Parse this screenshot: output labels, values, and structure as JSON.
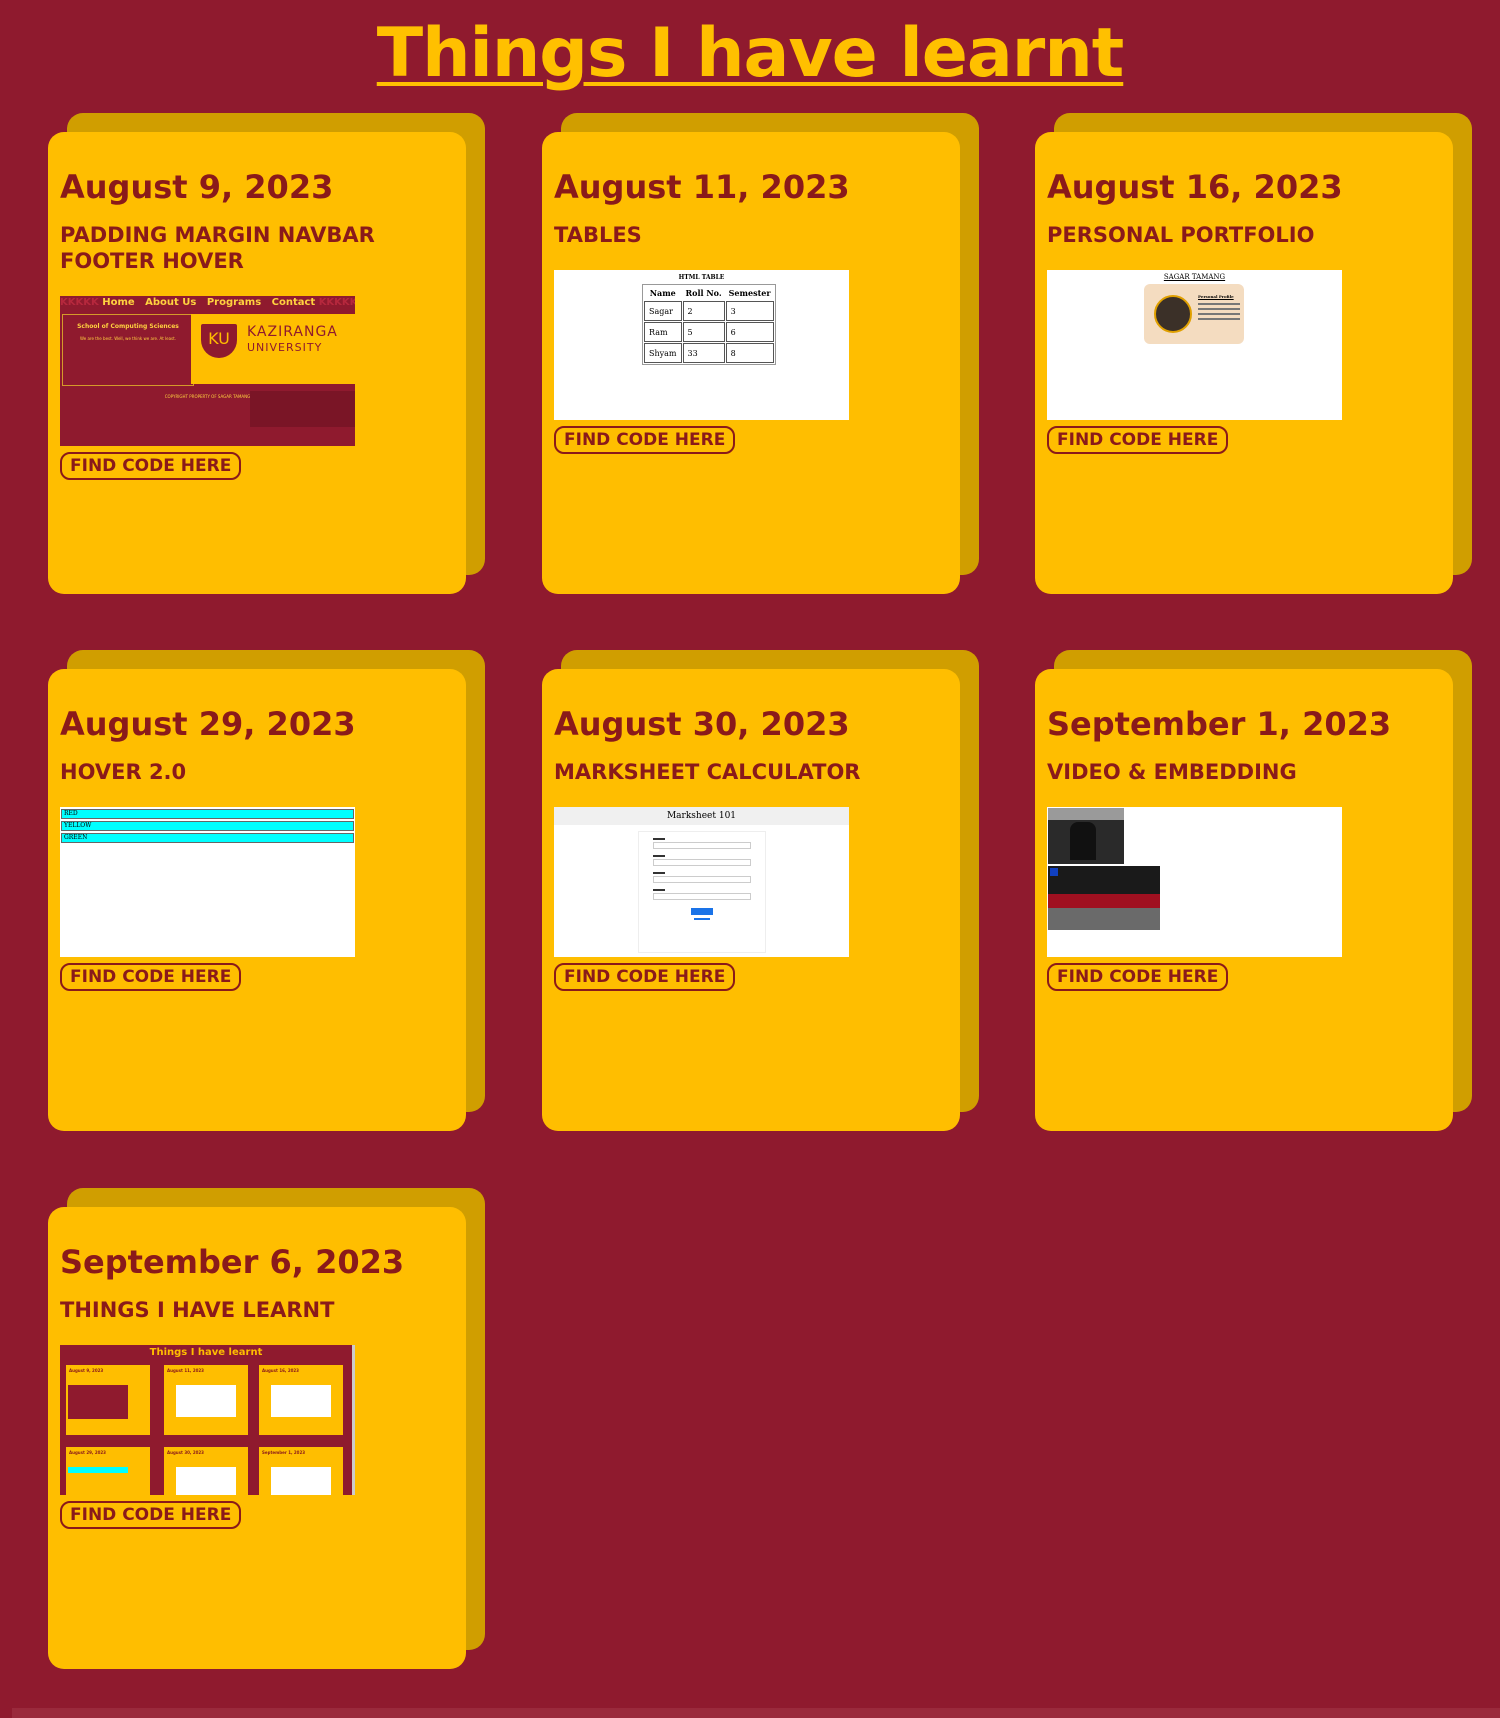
{
  "page": {
    "title": "Things I have learnt"
  },
  "cards": [
    {
      "date": "August 9, 2023",
      "title": "PADDING MARGIN NAVBAR FOOTER HOVER",
      "button": "FIND CODE HERE",
      "thumb": {
        "nav_filler": "KKKKK",
        "nav": [
          "Home",
          "About Us",
          "Programs",
          "Contact"
        ],
        "heading": "School of Computing Sciences",
        "tagline": "We are the best. Well, we think we are. At least.",
        "logo_mark": "KU",
        "logo_name_1": "KAZIRANGA",
        "logo_name_2": "UNIVERSITY",
        "footer": "COPYRIGHT PROPERTY OF SAGAR TAMANG"
      }
    },
    {
      "date": "August 11, 2023",
      "title": "TABLES",
      "button": "FIND CODE HERE",
      "thumb": {
        "caption": "HTML TABLE",
        "headers": [
          "Name",
          "Roll No.",
          "Semester"
        ],
        "rows": [
          [
            "Sagar",
            "2",
            "3"
          ],
          [
            "Ram",
            "5",
            "6"
          ],
          [
            "Shyam",
            "33",
            "8"
          ]
        ]
      }
    },
    {
      "date": "August 16, 2023",
      "title": "PERSONAL PORTFOLIO",
      "button": "FIND CODE HERE",
      "thumb": {
        "name": "SAGAR TAMANG",
        "profile_label": "Personal Profile"
      }
    },
    {
      "date": "August 29, 2023",
      "title": "HOVER 2.0",
      "button": "FIND CODE HERE",
      "thumb": {
        "bars": [
          "RED",
          "YELLOW",
          "GREEN"
        ]
      }
    },
    {
      "date": "August 30, 2023",
      "title": "MARKSHEET CALCULATOR",
      "button": "FIND CODE HERE",
      "thumb": {
        "heading": "Marksheet 101"
      }
    },
    {
      "date": "September 1, 2023",
      "title": "VIDEO & EMBEDDING",
      "button": "FIND CODE HERE",
      "thumb": {}
    },
    {
      "date": "September 6, 2023",
      "title": "THINGS I HAVE LEARNT",
      "button": "FIND CODE HERE",
      "thumb": {
        "title": "Things I have learnt",
        "mini_dates": [
          "August 9, 2023",
          "August 11, 2023",
          "August 16, 2023",
          "August 29, 2023",
          "August 30, 2023",
          "September 1, 2023"
        ]
      }
    }
  ],
  "colors": {
    "background": "#8f1a2e",
    "card": "#ffbe00",
    "card_shadow": "#d09e00",
    "text": "#8a1a1a"
  }
}
